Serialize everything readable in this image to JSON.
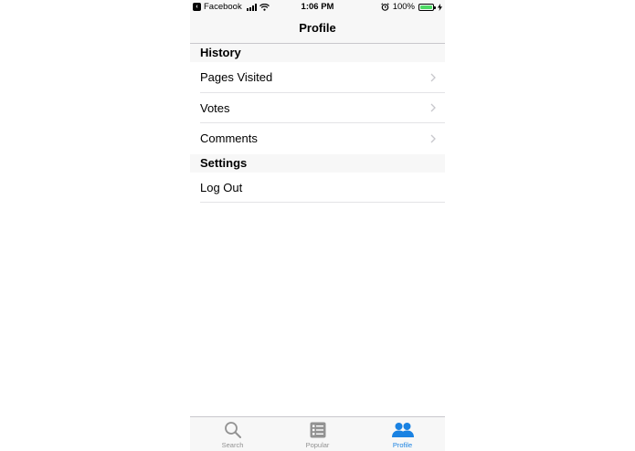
{
  "status_bar": {
    "back_app": "Facebook",
    "time": "1:06 PM",
    "battery": "100%",
    "battery_level": 1.0
  },
  "nav": {
    "title": "Profile"
  },
  "sections": [
    {
      "header": "History",
      "rows": [
        {
          "label": "Pages Visited",
          "chevron": true
        },
        {
          "label": "Votes",
          "chevron": true
        },
        {
          "label": "Comments",
          "chevron": true
        }
      ]
    },
    {
      "header": "Settings",
      "rows": [
        {
          "label": "Log Out",
          "chevron": false
        }
      ]
    }
  ],
  "tab_bar": {
    "tabs": [
      {
        "label": "Search",
        "icon": "search-icon",
        "active": false
      },
      {
        "label": "Popular",
        "icon": "list-icon",
        "active": false
      },
      {
        "label": "Profile",
        "icon": "people-icon",
        "active": true
      }
    ]
  },
  "colors": {
    "accent": "#1a82e2",
    "inactive": "#929292",
    "battery": "#4cd964",
    "separator": "#c8c7cc"
  }
}
